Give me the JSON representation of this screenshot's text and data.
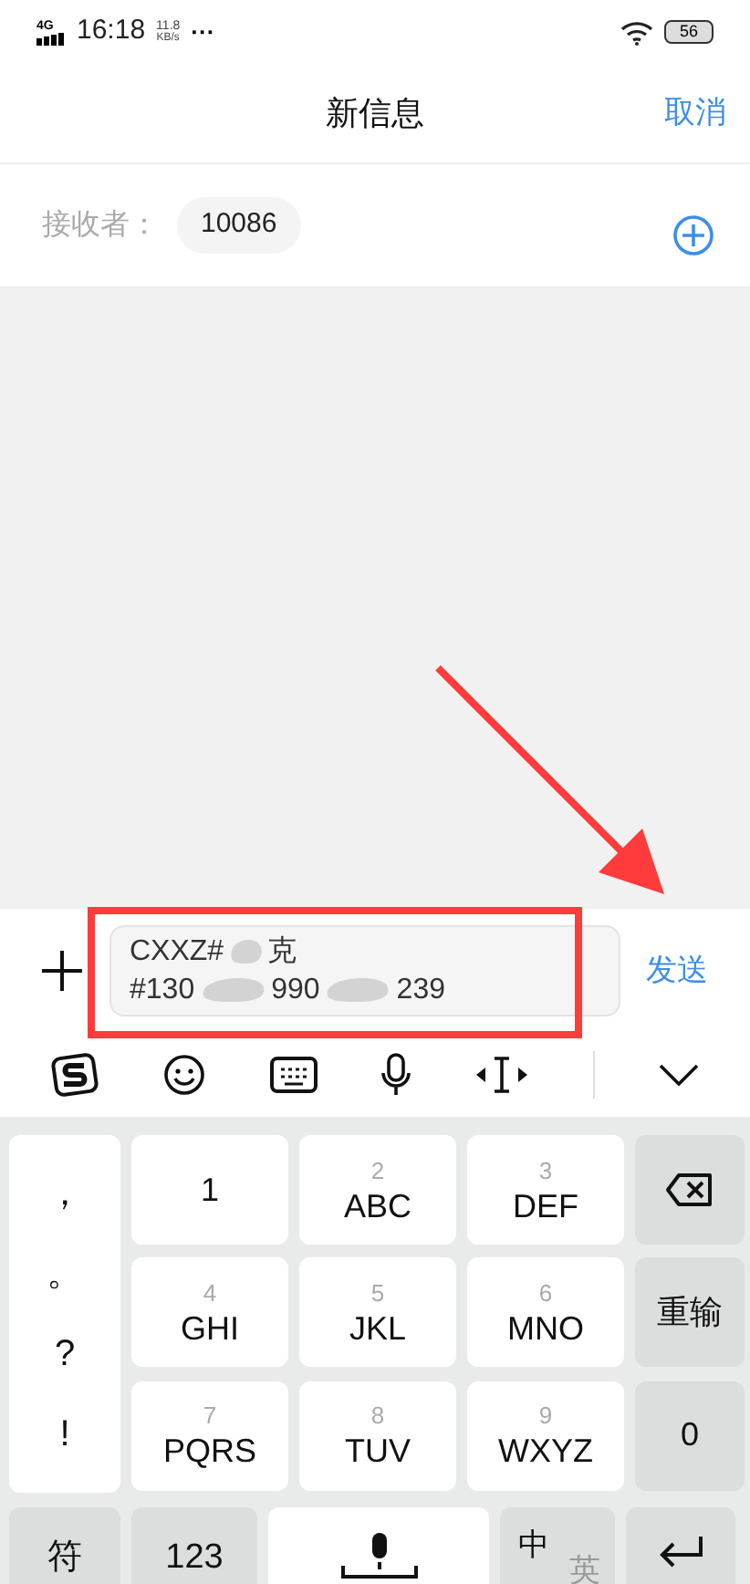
{
  "status_bar": {
    "network": "4G",
    "time": "16:18",
    "speed_value": "11.8",
    "speed_unit": "KB/s",
    "more": "···",
    "battery": "56"
  },
  "header": {
    "title": "新信息",
    "cancel": "取消"
  },
  "recipients": {
    "label": "接收者：",
    "chips": [
      "10086"
    ]
  },
  "compose": {
    "lines": [
      [
        "CXXZ#",
        "克"
      ],
      [
        "#130",
        "990",
        "239"
      ]
    ],
    "send": "发送"
  },
  "annotation": {
    "kind": "highlight-with-arrow"
  },
  "keyboard": {
    "symbols": [
      "，",
      "。",
      "?",
      "!"
    ],
    "keys": [
      {
        "kind": "digit",
        "letters": "1"
      },
      {
        "kind": "letters",
        "number": "2",
        "letters": "ABC"
      },
      {
        "kind": "letters",
        "number": "3",
        "letters": "DEF"
      },
      {
        "kind": "backspace"
      },
      {
        "kind": "letters",
        "number": "4",
        "letters": "GHI"
      },
      {
        "kind": "letters",
        "number": "5",
        "letters": "JKL"
      },
      {
        "kind": "letters",
        "number": "6",
        "letters": "MNO"
      },
      {
        "kind": "function",
        "label": "重输"
      },
      {
        "kind": "letters",
        "number": "7",
        "letters": "PQRS"
      },
      {
        "kind": "letters",
        "number": "8",
        "letters": "TUV"
      },
      {
        "kind": "letters",
        "number": "9",
        "letters": "WXYZ"
      },
      {
        "kind": "function",
        "label": "0"
      }
    ],
    "bottom": [
      {
        "kind": "function",
        "label": "符"
      },
      {
        "kind": "function",
        "label": "123"
      },
      {
        "kind": "space"
      },
      {
        "kind": "lang",
        "primary": "中",
        "secondary": "英"
      },
      {
        "kind": "enter"
      }
    ]
  }
}
